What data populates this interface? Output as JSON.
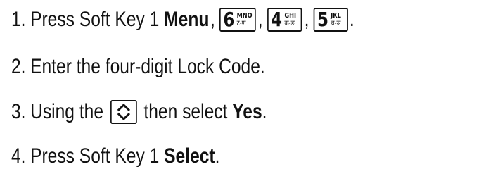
{
  "steps": [
    {
      "number": "1.",
      "text": "Press Soft Key 1",
      "bold": "Menu",
      "keys": [
        {
          "digit": "6",
          "letters": "MNO",
          "hindi": "ट-ण"
        },
        {
          "digit": "4",
          "letters": "GHI",
          "hindi": "क-ङ"
        },
        {
          "digit": "5",
          "letters": "JKL",
          "hindi": "च-ञ"
        }
      ],
      "sep": ",",
      "end": "."
    },
    {
      "number": "2.",
      "text": "Enter the four-digit Lock Code."
    },
    {
      "number": "3.",
      "text_before": "Using the",
      "text_after": "then select",
      "bold": "Yes",
      "end": "."
    },
    {
      "number": "4.",
      "text": "Press Soft Key 1",
      "bold": "Select",
      "end": "."
    }
  ],
  "icons": {
    "nav_key": "up-down-navigation-key-icon"
  }
}
